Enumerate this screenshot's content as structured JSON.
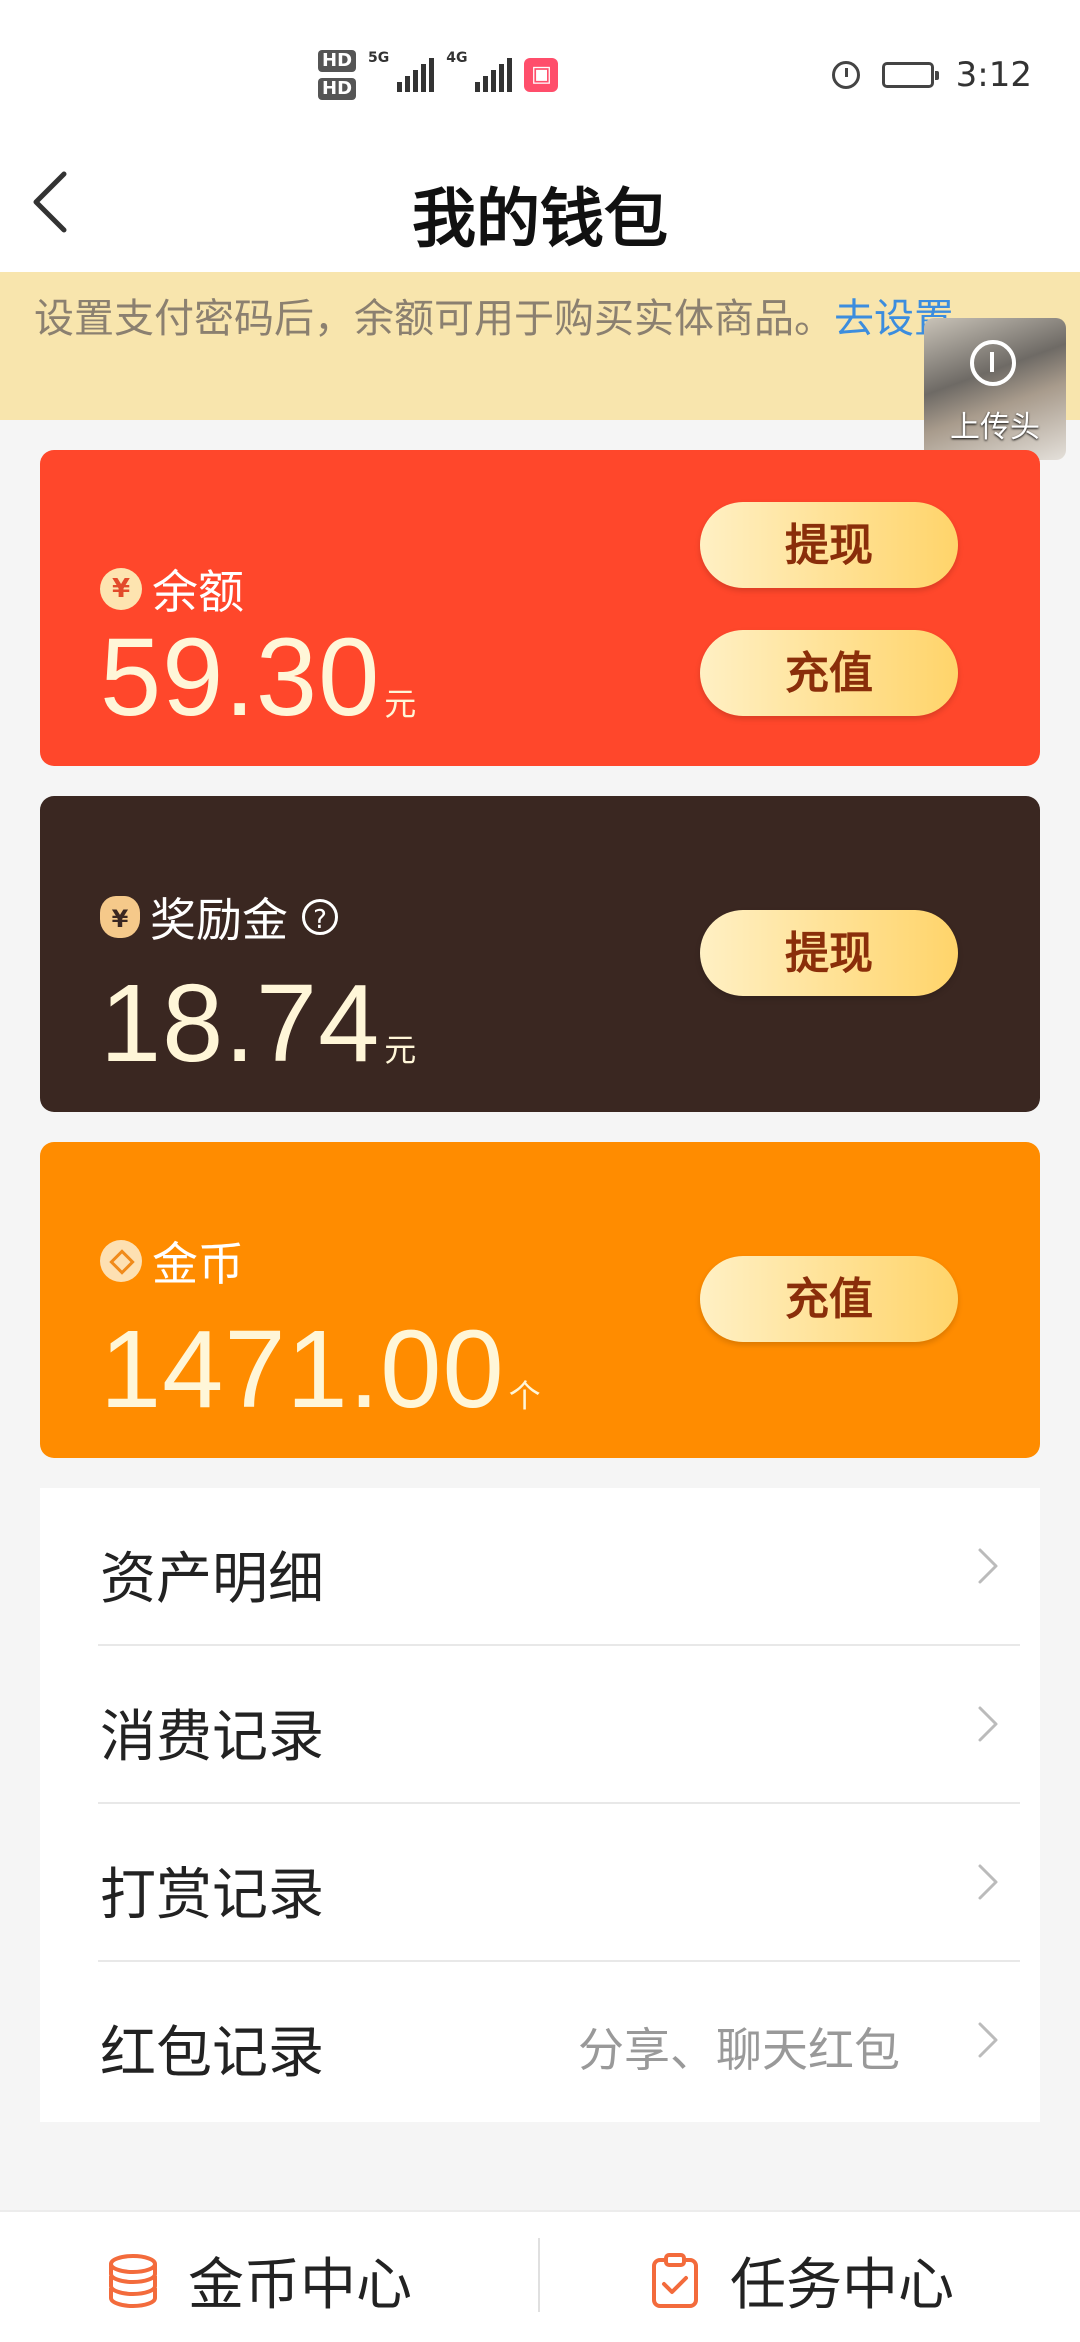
{
  "status_bar": {
    "hd_labels": [
      "HD",
      "HD"
    ],
    "sim1_net": "5G",
    "sim2_net": "4G",
    "time": "3:12"
  },
  "header": {
    "title": "我的钱包"
  },
  "notice": {
    "text": "设置支付密码后，余额可用于购买实体商品。",
    "link": "去设置"
  },
  "video_thumb": {
    "label": "上传头"
  },
  "balance_card": {
    "icon_glyph": "¥",
    "label": "余额",
    "amount": "59.30",
    "unit": "元",
    "withdraw": "提现",
    "recharge": "充值",
    "color": "#ff472b"
  },
  "bonus_card": {
    "icon_glyph": "¥",
    "label": "奖励金",
    "help": "?",
    "amount": "18.74",
    "unit": "元",
    "withdraw": "提现",
    "color": "#3a2721"
  },
  "coin_card": {
    "label": "金币",
    "amount": "1471.00",
    "unit": "个",
    "recharge": "充值",
    "color": "#ff8c00"
  },
  "list": [
    {
      "label": "资产明细",
      "sub": ""
    },
    {
      "label": "消费记录",
      "sub": ""
    },
    {
      "label": "打赏记录",
      "sub": ""
    },
    {
      "label": "红包记录",
      "sub": "分享、聊天红包"
    }
  ],
  "bottom_tabs": {
    "coin_center": "金币中心",
    "task_center": "任务中心"
  },
  "accent_color": "#f36b3c"
}
